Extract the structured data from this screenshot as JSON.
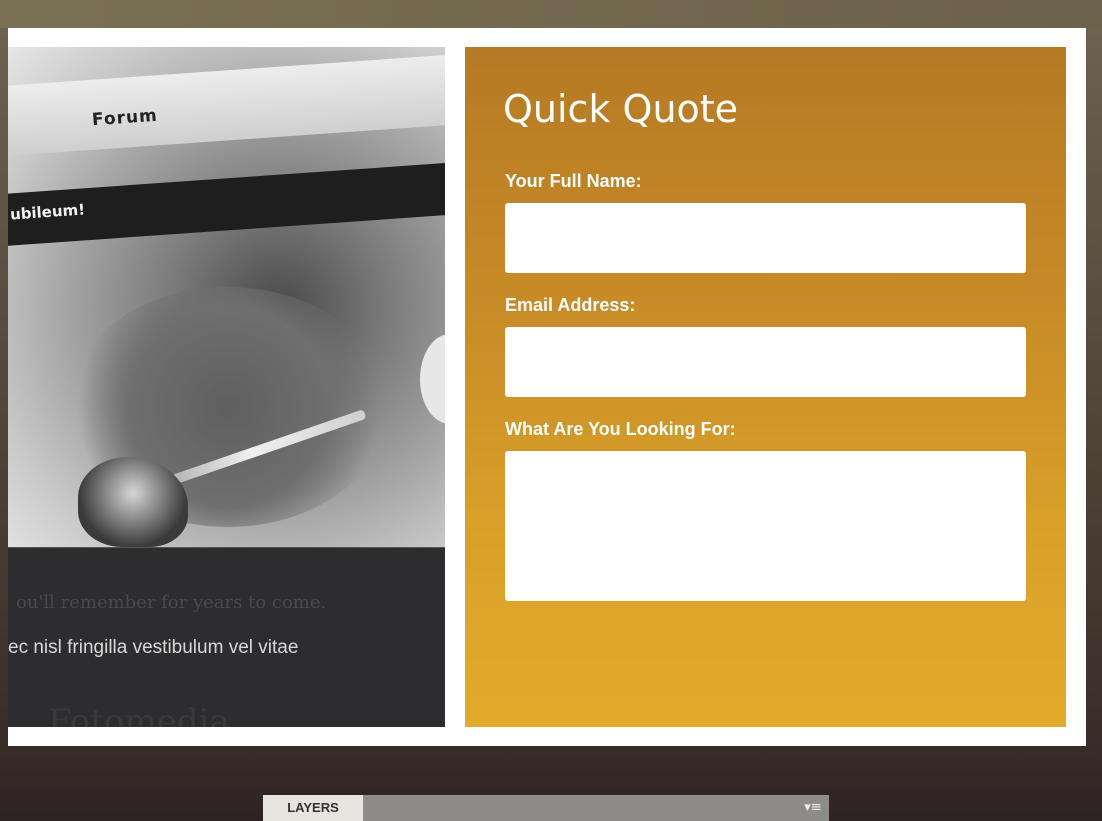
{
  "preview": {
    "forum_label": "Forum",
    "nav_text": "ubileum!",
    "tagline": "ou'll remember for years to come.",
    "body_text": "ec nisl fringilla vestibulum vel vitae",
    "faded_heading": "Fotomedia"
  },
  "quote_form": {
    "title": "Quick Quote",
    "name_label": "Your Full Name:",
    "name_value": "",
    "email_label": "Email Address:",
    "email_value": "",
    "looking_label": "What Are You Looking For:",
    "looking_value": ""
  },
  "layers_panel": {
    "tab_label": "LAYERS",
    "menu_icon": "panel-menu-icon"
  },
  "colors": {
    "panel_top": "#b57a24",
    "panel_bottom": "#e2ab2b",
    "background_dark": "#2e2224",
    "frame": "#ffffff"
  }
}
